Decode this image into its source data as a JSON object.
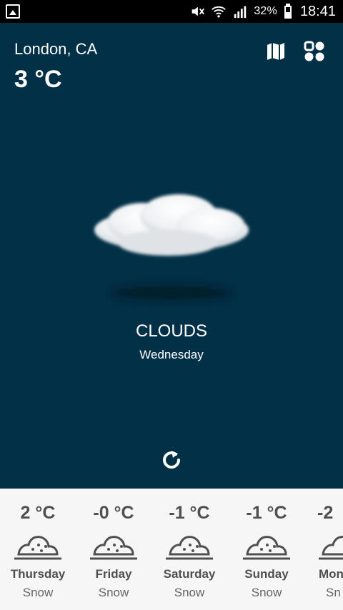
{
  "status_bar": {
    "battery_percent": "32%",
    "time": "18:41",
    "icons": [
      "gallery-icon",
      "mute-icon",
      "wifi-icon",
      "signal-icon",
      "battery-icon"
    ]
  },
  "weather": {
    "location": "London, CA",
    "temperature": "3 °C",
    "condition": "CLOUDS",
    "day": "Wednesday"
  },
  "actions": {
    "icons": [
      "map-icon",
      "grid-icon",
      "refresh-icon"
    ]
  },
  "forecast": [
    {
      "temp": "2 °C",
      "day": "Thursday",
      "desc": "Snow"
    },
    {
      "temp": "-0 °C",
      "day": "Friday",
      "desc": "Snow"
    },
    {
      "temp": "-1 °C",
      "day": "Saturday",
      "desc": "Snow"
    },
    {
      "temp": "-1 °C",
      "day": "Sunday",
      "desc": "Snow"
    },
    {
      "temp": "-2",
      "day": "Mon",
      "desc": "Sn"
    }
  ],
  "colors": {
    "main_background": "#023047",
    "forecast_background": "#f6f6f6",
    "forecast_text": "#505050"
  }
}
